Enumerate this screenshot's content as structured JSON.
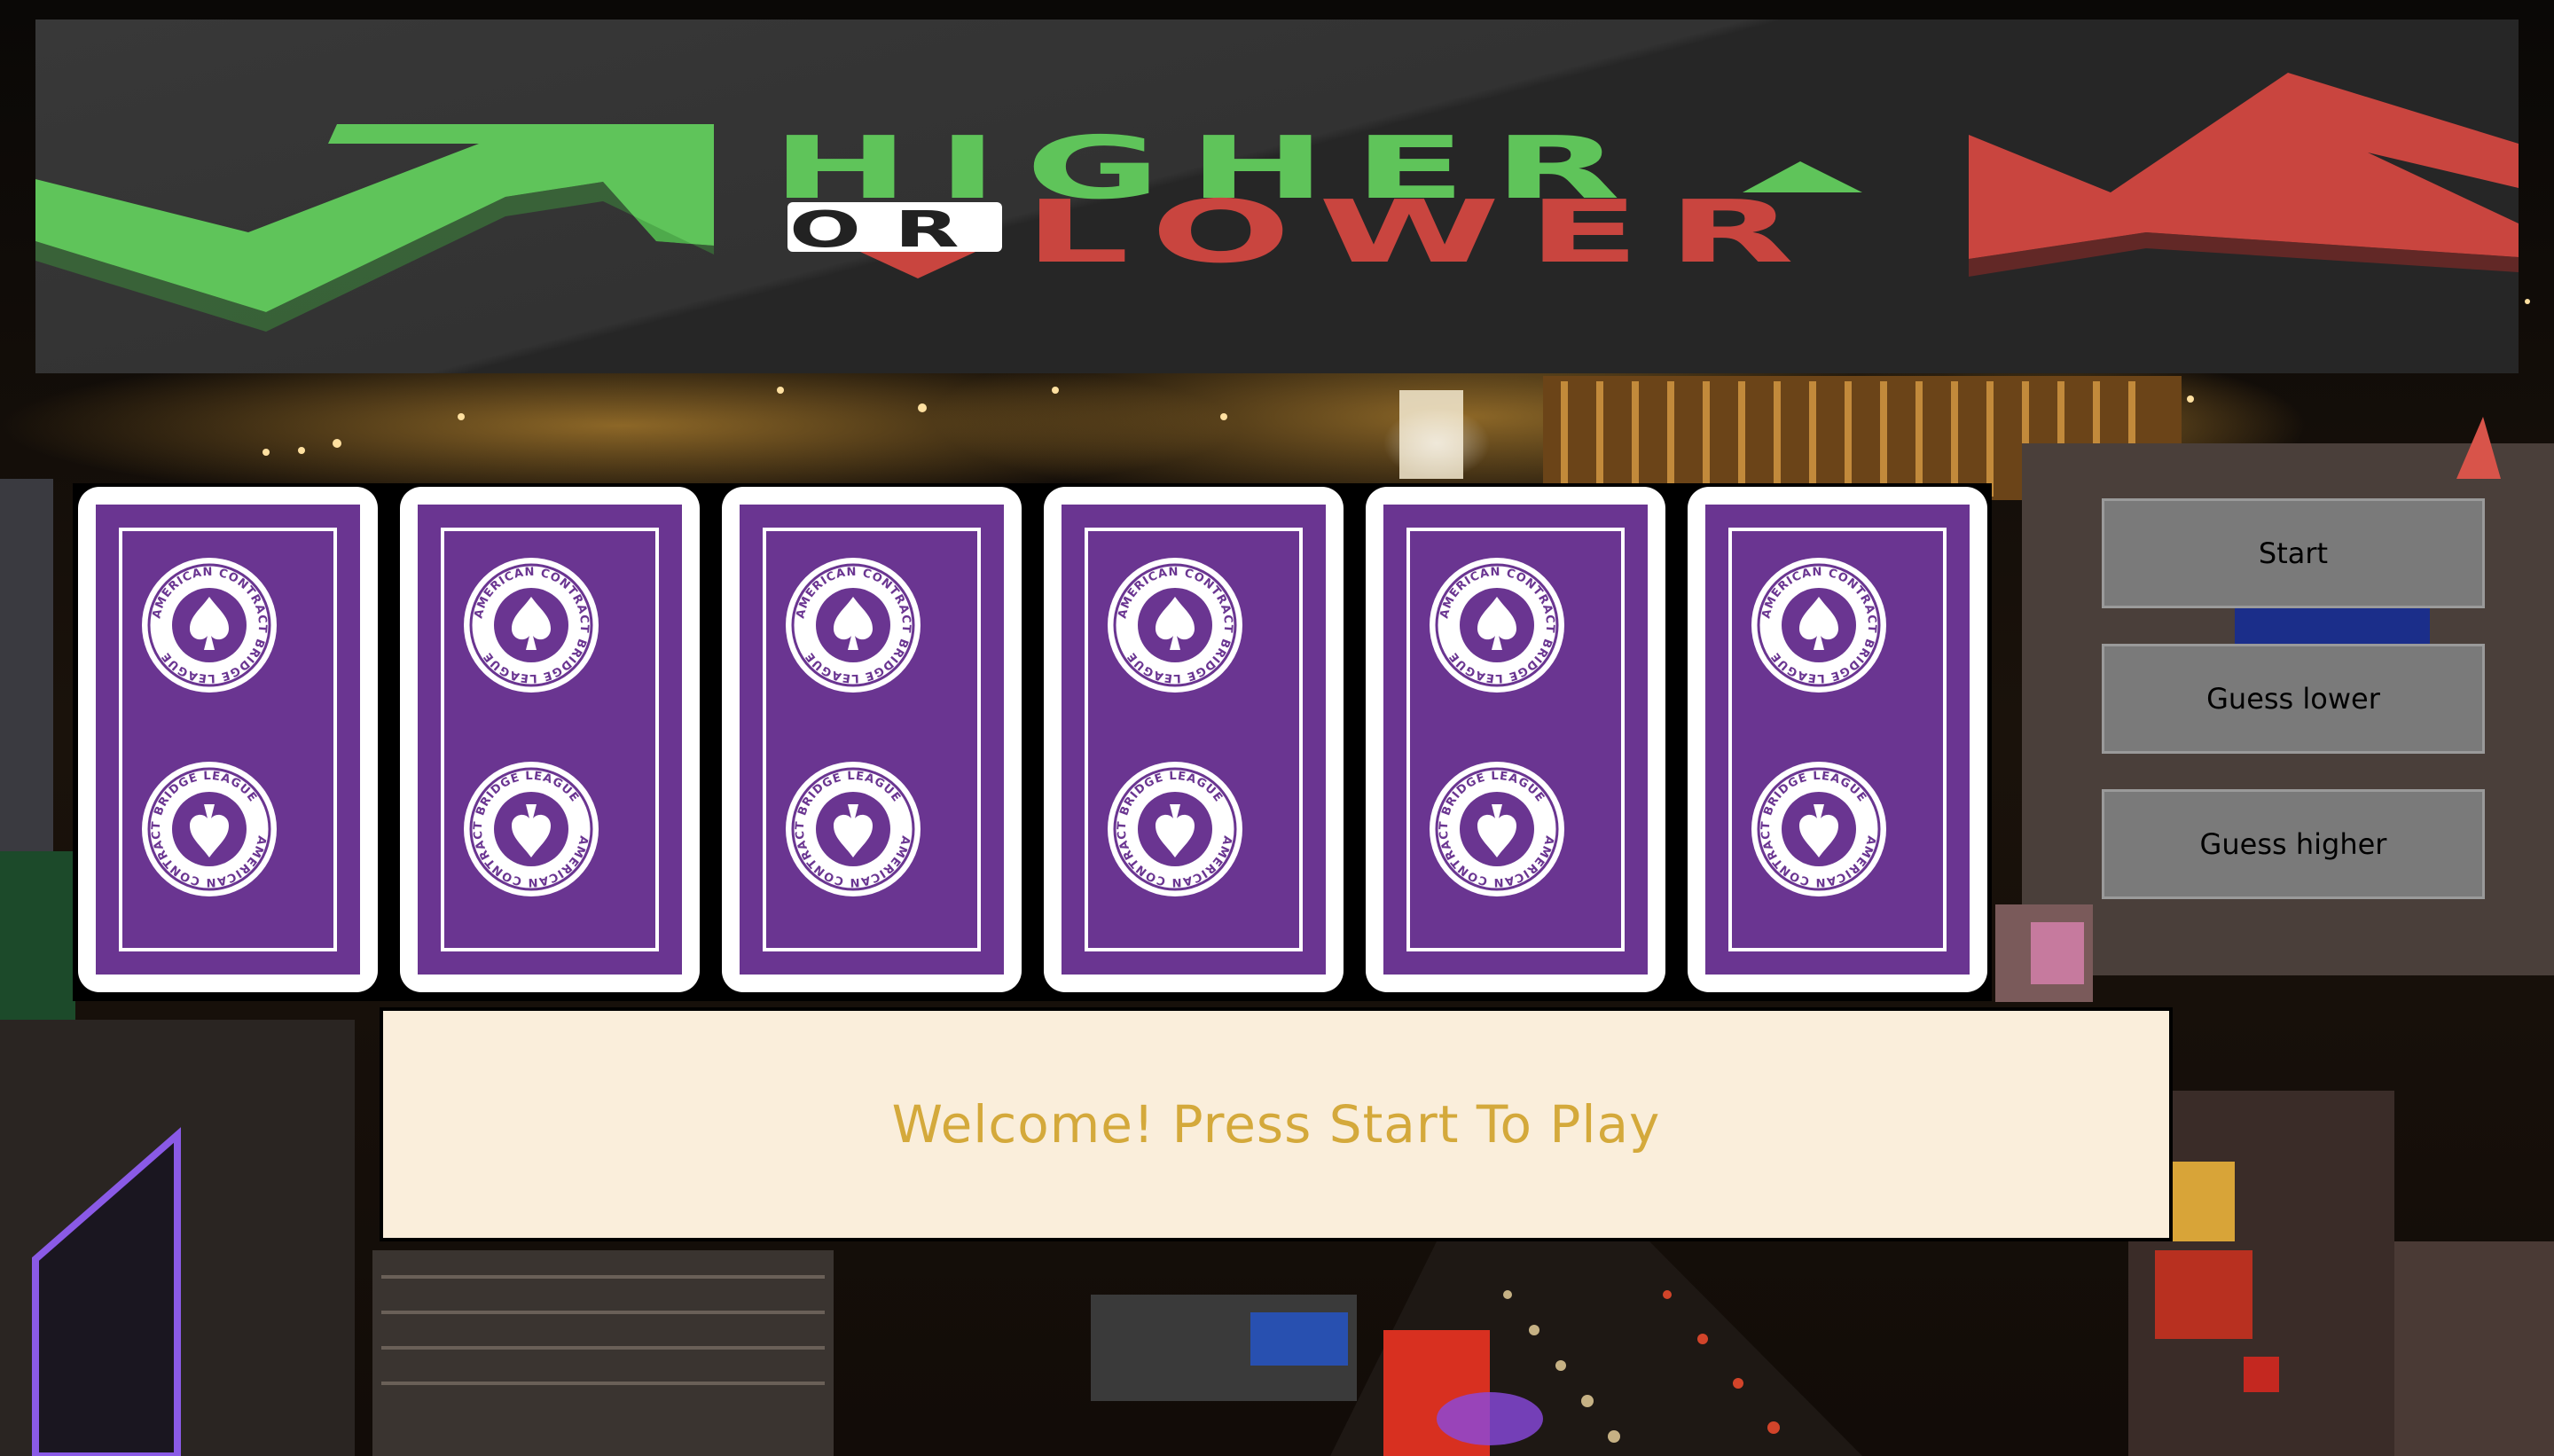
{
  "banner": {
    "logo_higher": "HIGHER",
    "logo_or": "OR",
    "logo_lower": "LOWER",
    "colors": {
      "higher": "#5fc45a",
      "lower": "#c9453f",
      "banner": "#2e2e2e"
    }
  },
  "cards": [
    {
      "face": "back",
      "emblem_text": "AMERICAN CONTRACT BRIDGE LEAGUE"
    },
    {
      "face": "back",
      "emblem_text": "AMERICAN CONTRACT BRIDGE LEAGUE"
    },
    {
      "face": "back",
      "emblem_text": "AMERICAN CONTRACT BRIDGE LEAGUE"
    },
    {
      "face": "back",
      "emblem_text": "AMERICAN CONTRACT BRIDGE LEAGUE"
    },
    {
      "face": "back",
      "emblem_text": "AMERICAN CONTRACT BRIDGE LEAGUE"
    },
    {
      "face": "back",
      "emblem_text": "AMERICAN CONTRACT BRIDGE LEAGUE"
    }
  ],
  "card_colors": {
    "back": "#6a3591",
    "border": "#ffffff"
  },
  "message": {
    "text": "Welcome! Press Start To Play",
    "color": "#d4a93b",
    "background": "#faeedb"
  },
  "controls": {
    "start_label": "Start",
    "lower_label": "Guess lower",
    "higher_label": "Guess higher"
  }
}
